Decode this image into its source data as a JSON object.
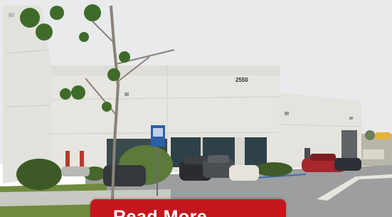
{
  "photo": {
    "building_number": "2550"
  },
  "overlay_button": {
    "label": "Read More",
    "color": "#c3171d"
  }
}
